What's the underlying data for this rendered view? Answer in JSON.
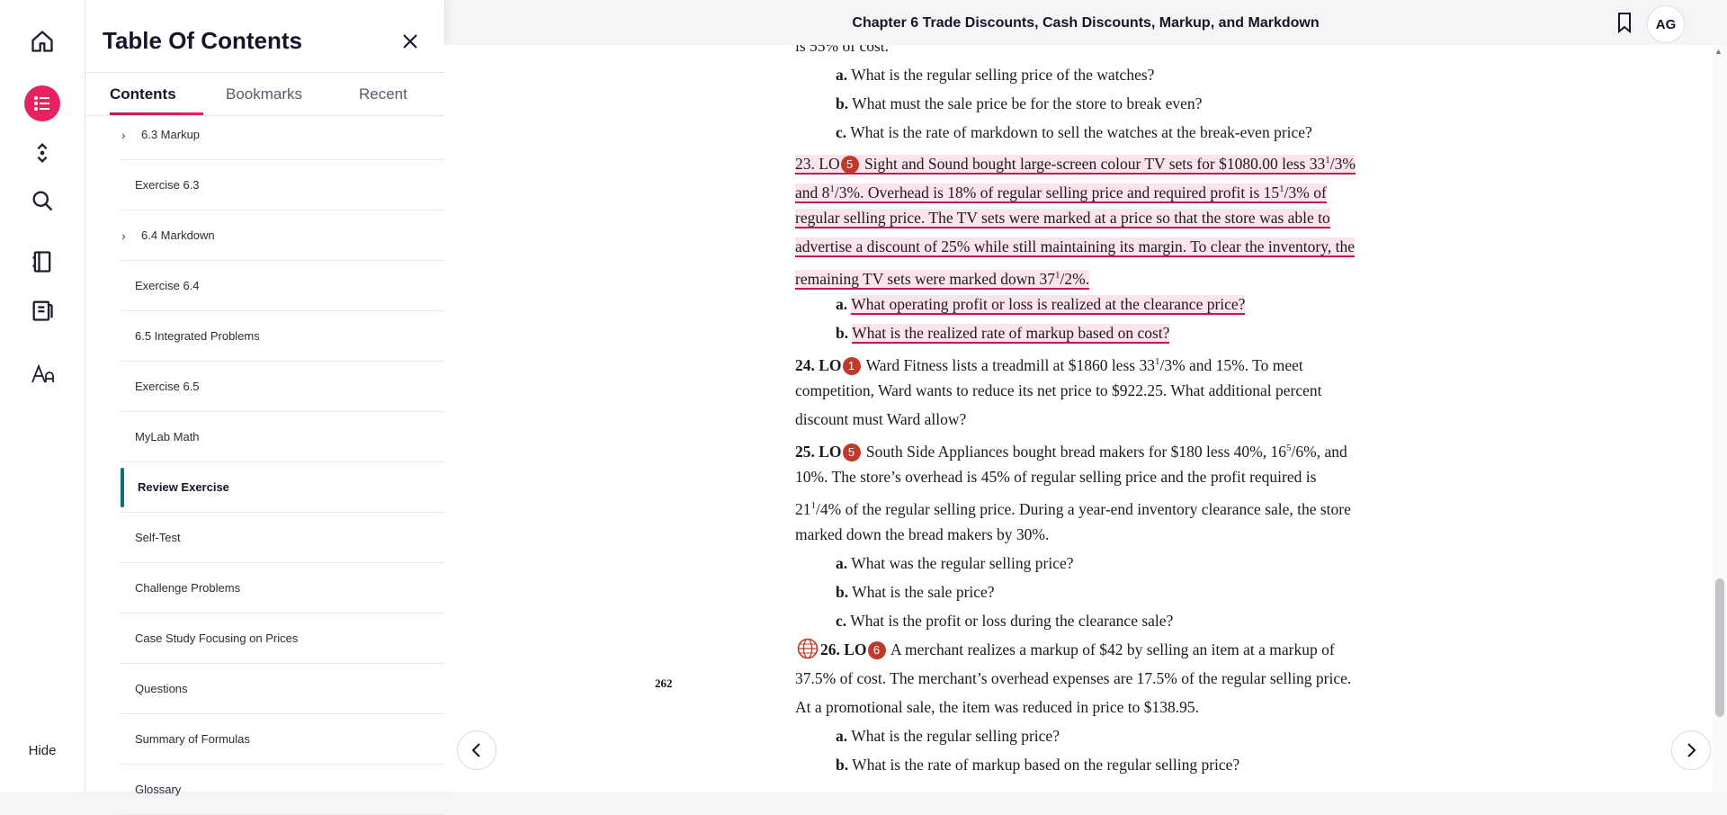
{
  "rail": {
    "hide_label": "Hide"
  },
  "toc": {
    "title": "Table Of Contents",
    "tabs": [
      "Contents",
      "Bookmarks",
      "Recent"
    ],
    "items": [
      {
        "label": "6.3 Markup",
        "expandable": true
      },
      {
        "label": "Exercise 6.3",
        "expandable": false
      },
      {
        "label": "6.4 Markdown",
        "expandable": true
      },
      {
        "label": "Exercise 6.4",
        "expandable": false
      },
      {
        "label": "6.5 Integrated Problems",
        "expandable": false
      },
      {
        "label": "Exercise 6.5",
        "expandable": false
      },
      {
        "label": "MyLab Math",
        "expandable": false
      },
      {
        "label": "Review Exercise",
        "expandable": false,
        "selected": true
      },
      {
        "label": "Self-Test",
        "expandable": false
      },
      {
        "label": "Challenge Problems",
        "expandable": false
      },
      {
        "label": "Case Study Focusing on Prices",
        "expandable": false
      },
      {
        "label": "Questions",
        "expandable": false
      },
      {
        "label": "Summary of Formulas",
        "expandable": false
      },
      {
        "label": "Glossary",
        "expandable": false
      }
    ]
  },
  "header": {
    "title": "Chapter 6 Trade Discounts, Cash Discounts, Markup, and Markdown",
    "avatar": "AG"
  },
  "page": {
    "page_number": "262",
    "cut_top": "is 55% of cost.",
    "q22": {
      "a": "What is the regular selling price of the watches?",
      "b": "What must the sale price be for the store to break even?",
      "c": "What is the rate of markdown to sell the watches at the break-even price?"
    },
    "q23": {
      "num": "23. LO",
      "lo": "5",
      "l1": " Sight and Sound bought large-screen colour TV sets for $1080.00 less 33",
      "l1b": "/",
      "l1c": "3%",
      "l2a": "and 8",
      "l2b": "/",
      "l2c": "3%. Overhead is 18% of regular selling price and required profit is 15",
      "l2d": "/",
      "l2e": "3% of",
      "l3": "regular selling price. The TV sets were marked at a price so that the store was able to",
      "l4": "advertise a discount of 25% while still maintaining its margin. To clear the inventory, the",
      "l5a": "remaining TV sets were marked down 37",
      "l5b": "/",
      "l5c": "2%.",
      "a": "What operating profit or loss is realized at the clearance price?",
      "b": "What is the realized rate of markup based on cost?"
    },
    "q24": {
      "num": "24. LO",
      "lo": "1",
      "l1a": " Ward Fitness lists a treadmill at $1860 less 33",
      "l1b": "/",
      "l1c": "3% and 15%. To meet",
      "l2": "competition, Ward wants to reduce its net price to $922.25. What additional percent",
      "l3": "discount must Ward allow?"
    },
    "q25": {
      "num": "25. LO",
      "lo": "5",
      "l1a": " South Side Appliances bought bread makers for $180 less 40%, 16",
      "l1b": "/",
      "l1c": "6%, and",
      "l2": "10%. The store’s overhead is 45% of regular selling price and the profit required is",
      "l3a": "21",
      "l3b": "/",
      "l3c": "4% of the regular selling price. During a year-end inventory clearance sale, the store",
      "l4": "marked down the bread makers by 30%.",
      "a": "What was the regular selling price?",
      "b": "What is the sale price?",
      "c": "What is the profit or loss during the clearance sale?"
    },
    "q26": {
      "num": "26. LO",
      "lo": "6",
      "l1": " A merchant realizes a markup of $42 by selling an item at a markup of",
      "l2": "37.5% of cost. The merchant’s overhead expenses are 17.5% of the regular selling price.",
      "l3": "At a promotional sale, the item was reduced in price to $138.95.",
      "a": "What is the regular selling price?",
      "b": "What is the rate of markup based on the regular selling price?"
    },
    "sup": {
      "one": "1",
      "five": "5"
    },
    "labels": {
      "a": "a.",
      "b": "b.",
      "c": "c."
    }
  }
}
